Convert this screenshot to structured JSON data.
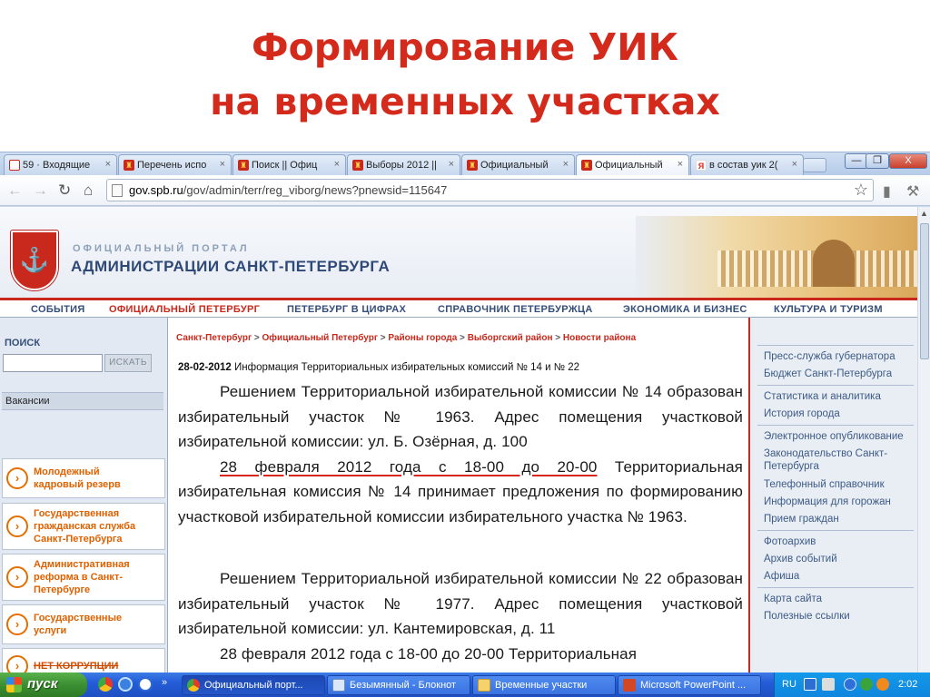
{
  "slide": {
    "title_line1": "Формирование УИК",
    "title_line2": "на временных участках"
  },
  "browser": {
    "tabs": [
      {
        "label": "59 · Входящие",
        "icon": "mail-icon"
      },
      {
        "label": "Перечень испо",
        "icon": "spb-crest-icon"
      },
      {
        "label": "Поиск || Офиц",
        "icon": "spb-crest-icon"
      },
      {
        "label": "Выборы 2012 ||",
        "icon": "spb-crest-icon"
      },
      {
        "label": "Официальный",
        "icon": "spb-crest-icon"
      },
      {
        "label": "Официальный",
        "icon": "spb-crest-icon"
      },
      {
        "label": "в состав уик 2(",
        "icon": "yandex-icon"
      }
    ],
    "close_glyph": "×",
    "url_host": "gov.spb.ru",
    "url_path": "/gov/admin/terr/reg_viborg/news?pnewsid=115647",
    "window_buttons": {
      "minimize": "—",
      "maximize": "❐",
      "close": "X"
    }
  },
  "site": {
    "portal_small": "ОФИЦИАЛЬНЫЙ ПОРТАЛ",
    "portal_big": "АДМИНИСТРАЦИИ САНКТ-ПЕТЕРБУРГА",
    "nav": [
      "СОБЫТИЯ",
      "ОФИЦИАЛЬНЫЙ ПЕТЕРБУРГ",
      "ПЕТЕРБУРГ В ЦИФРАХ",
      "СПРАВОЧНИК ПЕТЕРБУРЖЦА",
      "ЭКОНОМИКА И БИЗНЕС",
      "КУЛЬТУРА И ТУРИЗМ"
    ],
    "search_label": "ПОИСК",
    "search_button": "ИСКАТЬ",
    "vacancies": "Вакансии",
    "promos": [
      {
        "l1": "Молодежный",
        "l2": "кадровый резерв",
        "l3": ""
      },
      {
        "l1": "Государственная",
        "l2": "гражданская служба",
        "l3": "Санкт-Петербурга"
      },
      {
        "l1": "Административная",
        "l2": "реформа в Санкт-",
        "l3": "Петербурге"
      },
      {
        "l1": "Государственные",
        "l2": "услуги",
        "l3": ""
      },
      {
        "l1": "НЕТ КОРРУПЦИИ",
        "l2": "",
        "l3": ""
      }
    ],
    "breadcrumb": [
      "Санкт-Петербург",
      "Официальный Петербург",
      "Районы города",
      "Выборгский район",
      "Новости района"
    ],
    "breadcrumb_sep": " > ",
    "news_date": "28-02-2012",
    "news_title": " Информация Территориальных избирательных комиссий № 14 и № 22",
    "para1_intro": "Решением Территориальной избирательной комиссии № 14 образован избирательный участок № 1963. Адрес помещения участковой избирательной комиссии: ул. Б. Озёрная, д. 100",
    "para1_date": "28 февраля 2012 года с 18-00 до 20-00",
    "para1_rest": " Территориальная избирательная комиссия № 14 принимает предложения по формированию участковой избирательной комиссии избирательного участка № 1963.",
    "para2_intro": "Решением Территориальной избирательной комиссии № 22 образован избирательный участок № 1977. Адрес помещения участковой избирательной комиссии: ул. Кантемировская, д. 11",
    "para2_date": "28 февраля 2012 года с 18-00 до 20-00",
    "para2_rest": " Территориальная",
    "right_links": [
      "Пресс-служба губернатора",
      "Бюджет Санкт-Петербурга",
      "Статистика и аналитика",
      "История города",
      "Электронное опубликование",
      "Законодательство Санкт-",
      "Петербурга",
      "Телефонный справочник",
      "Информация для горожан",
      "Прием граждан",
      "Фотоархив",
      "Архив событий",
      "Афиша",
      "Карта сайта",
      "Полезные ссылки"
    ]
  },
  "taskbar": {
    "start": "пуск",
    "tasks": [
      "Официальный порт...",
      "Безымянный - Блокнот",
      "Временные участки",
      "Microsoft PowerPoint ..."
    ],
    "lang": "RU",
    "clock": "2:02"
  },
  "colors": {
    "title_red": "#d42a1c",
    "portal_red": "#c8291c",
    "portal_blue": "#2e4877",
    "link_orange": "#e06100",
    "xp_blue": "#245dd8"
  }
}
